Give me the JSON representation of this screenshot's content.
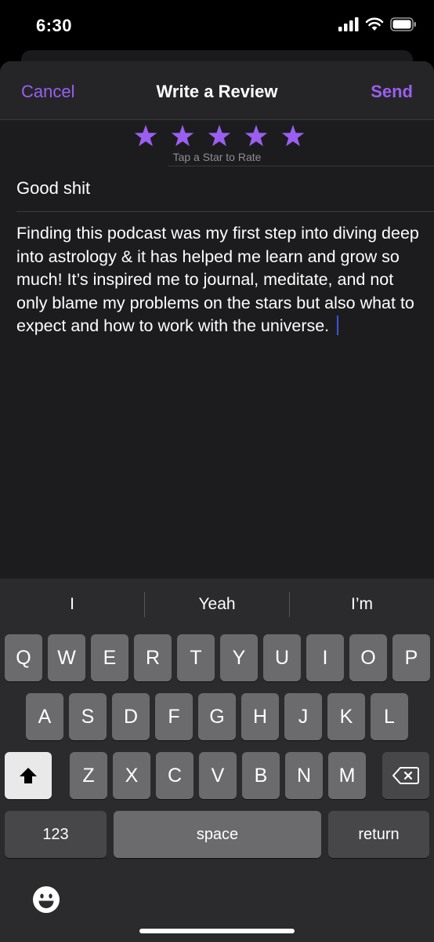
{
  "status_bar": {
    "time": "6:30"
  },
  "nav": {
    "cancel": "Cancel",
    "title": "Write a Review",
    "send": "Send"
  },
  "rating": {
    "stars": 5,
    "hint": "Tap a Star to Rate"
  },
  "review": {
    "title": "Good shit",
    "body": "Finding this podcast was my first step into diving deep into astrology & it has helped me learn  and grow so much! It’s inspired me to journal, meditate, and not only blame my problems on the stars but also what to expect and how to work with the universe. "
  },
  "keyboard": {
    "suggestions": [
      "I",
      "Yeah",
      "I’m"
    ],
    "row1": [
      "Q",
      "W",
      "E",
      "R",
      "T",
      "Y",
      "U",
      "I",
      "O",
      "P"
    ],
    "row2": [
      "A",
      "S",
      "D",
      "F",
      "G",
      "H",
      "J",
      "K",
      "L"
    ],
    "row3": [
      "Z",
      "X",
      "C",
      "V",
      "B",
      "N",
      "M"
    ],
    "numbers_key": "123",
    "space_key": "space",
    "return_key": "return"
  },
  "colors": {
    "accent": "#9a5ff0",
    "background": "#1c1c1e",
    "keyboard": "#2b2b2d"
  }
}
